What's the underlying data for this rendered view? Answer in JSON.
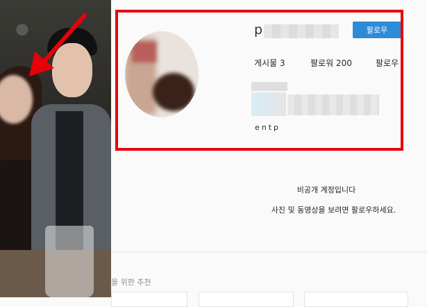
{
  "profile": {
    "username_visible": "p",
    "follow_button": "팔로우",
    "stats": {
      "posts": "게시물 3",
      "followers": "팔로워 200",
      "following": "팔로우"
    },
    "bio": "entp"
  },
  "private_notice": {
    "title": "비공개 계정입니다",
    "description": "사진 및 동영상을 보려면 팔로우하세요."
  },
  "suggestions": {
    "label": "을 위한 추천"
  },
  "colors": {
    "accent": "#2e8bd8",
    "highlight_frame": "#e8000b",
    "arrow": "#e8000b"
  }
}
